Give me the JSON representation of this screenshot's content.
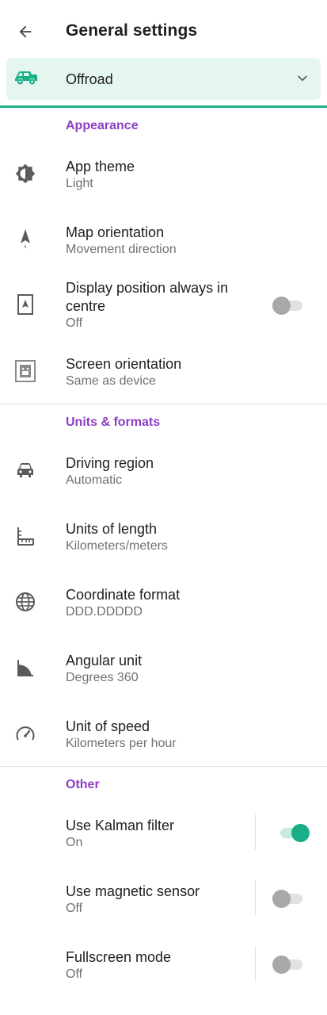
{
  "header": {
    "title": "General settings",
    "back_icon": "arrow-back-icon"
  },
  "profile": {
    "label": "Offroad",
    "icon": "offroad-car-icon",
    "accent": "#27b08e",
    "background": "#e5f6f1"
  },
  "sections": {
    "appearance": {
      "title": "Appearance",
      "items": [
        {
          "title": "App theme",
          "value": "Light",
          "icon": "theme-icon"
        },
        {
          "title": "Map orientation",
          "value": "Movement direction",
          "icon": "navigation-arrow-icon"
        },
        {
          "title_line1": "Display position always in",
          "title_line2": "centre",
          "value": "Off",
          "icon": "position-center-icon",
          "toggle_on": false
        },
        {
          "title": "Screen orientation",
          "value": "Same as device",
          "icon": "screen-rotation-icon"
        }
      ]
    },
    "units": {
      "title": "Units & formats",
      "items": [
        {
          "title": "Driving region",
          "value": "Automatic",
          "icon": "car-icon"
        },
        {
          "title": "Units of length",
          "value": "Kilometers/meters",
          "icon": "ruler-icon"
        },
        {
          "title": "Coordinate format",
          "value": "DDD.DDDDD",
          "icon": "globe-icon"
        },
        {
          "title": "Angular unit",
          "value": "Degrees 360",
          "icon": "angle-icon"
        },
        {
          "title": "Unit of speed",
          "value": "Kilometers per hour",
          "icon": "speedometer-icon"
        }
      ]
    },
    "other": {
      "title": "Other",
      "items": [
        {
          "title": "Use Kalman filter",
          "value": "On",
          "toggle_on": true
        },
        {
          "title": "Use magnetic sensor",
          "value": "Off",
          "toggle_on": false
        },
        {
          "title": "Fullscreen mode",
          "value": "Off",
          "toggle_on": false
        }
      ]
    }
  },
  "colors": {
    "section_title": "#8e3ec4",
    "toggle_on": "#1aae86",
    "toggle_off": "#a8a8a8"
  }
}
